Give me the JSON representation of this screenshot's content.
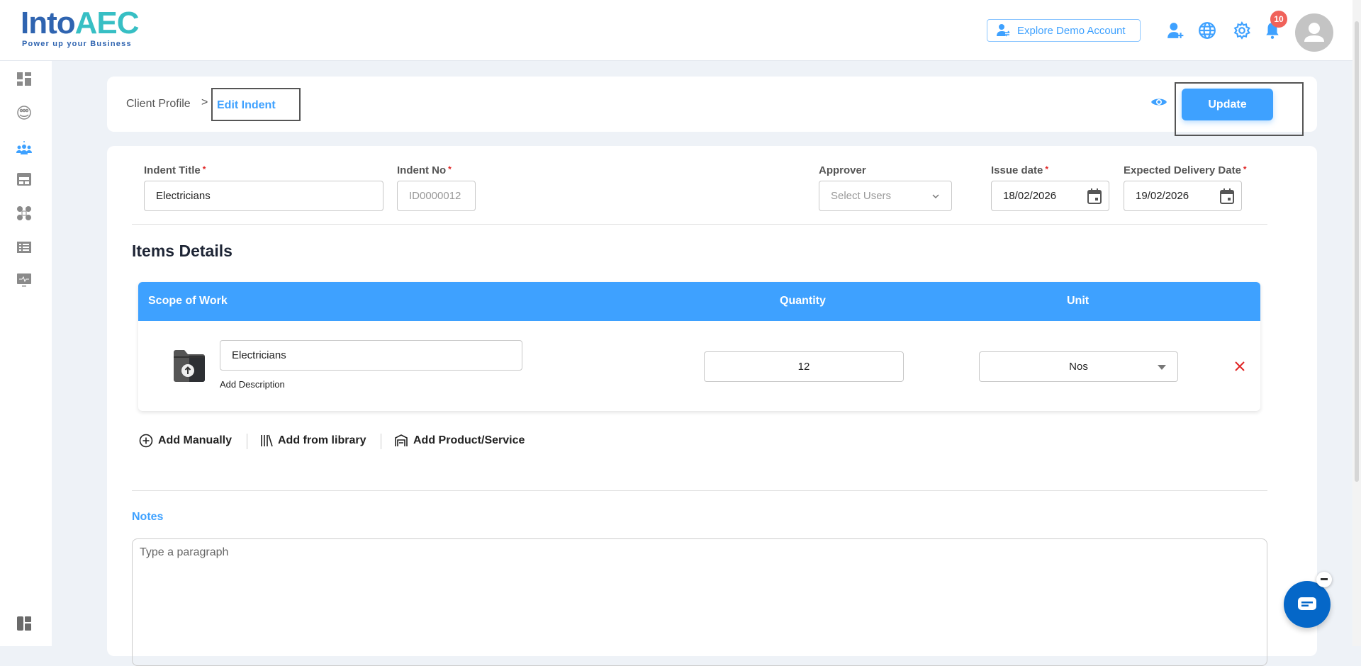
{
  "header": {
    "logo_text_a": "Into",
    "logo_text_b": "AEC",
    "logo_tagline": "Power up your Business",
    "demo_button": "Explore Demo Account",
    "notification_count": "10"
  },
  "sidebar": {
    "items": [
      "dashboard-icon",
      "clients-icon",
      "team-icon",
      "billing-icon",
      "modules-icon",
      "list-icon",
      "monitor-icon"
    ],
    "active_index": 2
  },
  "breadcrumb": {
    "parent": "Client Profile",
    "separator": ">",
    "current": "Edit Indent"
  },
  "toolbar": {
    "update_label": "Update"
  },
  "form": {
    "indent_title": {
      "label": "Indent Title",
      "required": "*",
      "value": "Electricians"
    },
    "indent_no": {
      "label": "Indent No",
      "required": "*",
      "value": "ID0000012"
    },
    "approver": {
      "label": "Approver",
      "placeholder": "Select Users"
    },
    "issue_date": {
      "label": "Issue date",
      "required": "*",
      "value": "18/02/2026"
    },
    "delivery_date": {
      "label": "Expected Delivery Date",
      "required": "*",
      "value": "19/02/2026"
    }
  },
  "items": {
    "title": "Items Details",
    "columns": [
      "Scope of Work",
      "Quantity",
      "Unit"
    ],
    "rows": [
      {
        "scope": "Electricians",
        "add_description": "Add Description",
        "quantity": "12",
        "unit": "Nos"
      }
    ],
    "actions": {
      "add_manually": "Add Manually",
      "add_library": "Add from library",
      "add_product": "Add Product/Service"
    }
  },
  "notes": {
    "label": "Notes",
    "placeholder": "Type a paragraph"
  },
  "colors": {
    "accent": "#3ea1ff",
    "danger": "#e02424",
    "chat": "#0567c8"
  }
}
